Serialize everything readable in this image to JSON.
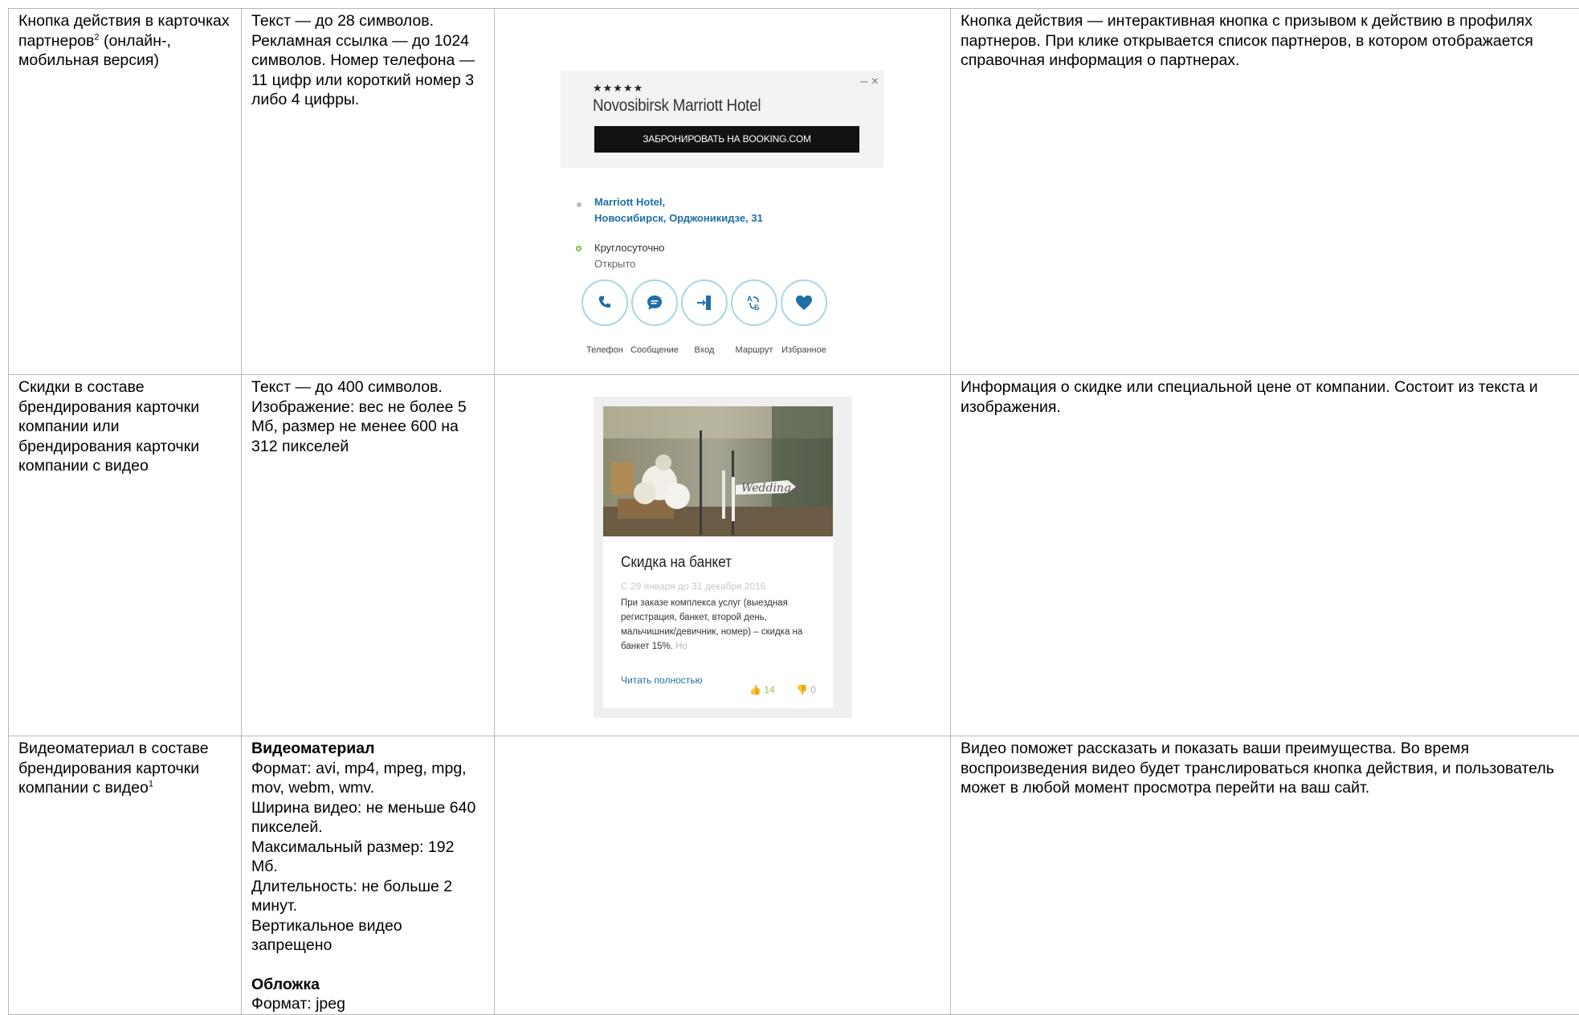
{
  "rows": [
    {
      "name": "Кнопка действия в карточках партнеров",
      "name_sup": "2",
      "name_tail": "(онлайн-, мобильная версия)",
      "requirements": "Текст — до 28 символов. Рекламная ссылка — до 1024 символов. Номер телефона — 11 цифр или короткий номер 3 либо 4 цифры.",
      "description": "Кнопка действия — интерактивная кнопка с призывом к действию в профилях партнеров. При клике открывается список партнеров, в котором отображается справочная информация о партнерах."
    },
    {
      "name": "Скидки в составе брендирования карточки компании или брендирования карточки компании с видео",
      "requirements": "Текст — до 400 символов. Изображение: вес не более 5 Мб, размер не менее 600 на 312 пикселей",
      "description": "Информация о скидке или специальной цене от компании. Состоит из текста и изображения."
    },
    {
      "name": "Видеоматериал в составе брендирования карточки компании с видео",
      "name_sup": "1",
      "video_heading": "Видеоматериал",
      "video_lines": [
        "Формат: avi, mp4, mpeg, mpg, mov, webm, wmv.",
        "Ширина видео: не меньше 640 пикселей.",
        "Максимальный размер: 192 Мб.",
        "Длительность: не больше 2 минут.",
        "Вертикальное видео запрещено"
      ],
      "cover_heading": "Обложка",
      "cover_line": "Формат: jpeg",
      "description": "Видео поможет рассказать и показать ваши преимущества. Во время воспроизведения видео будет транслироваться кнопка действия, и пользователь может в любой момент просмотра перейти на ваш сайт."
    }
  ],
  "partner_card": {
    "stars": "★★★★★",
    "controls": "– ×",
    "hotel": "Novosibirsk Marriott Hotel",
    "book_button": "ЗАБРОНИРОВАТЬ НА BOOKING.COM",
    "address_line1": "Marriott Hotel,",
    "address_line2": "Новосибирск, Орджоникидзе, 31",
    "hours": "Круглосуточно",
    "open_status": "Открыто",
    "actions": [
      {
        "label": "Телефон",
        "icon": "phone-icon"
      },
      {
        "label": "Сообщение",
        "icon": "message-icon"
      },
      {
        "label": "Вход",
        "icon": "entrance-icon"
      },
      {
        "label": "Маршрут",
        "icon": "route-icon"
      },
      {
        "label": "Избранное",
        "icon": "heart-icon"
      }
    ],
    "accent": "#1f6ea8"
  },
  "discount_card": {
    "photo_sign": "Wedding",
    "title": "Скидка на банкет",
    "date": "С 29 января до 31 декабря 2016",
    "text": "При заказе комплекса услуг (выездная регистрация, банкет, второй день, мальчишник/девичник, номер) – скидка на банкет 15%.",
    "text_fade": "Но",
    "read_more": "Читать полностью",
    "likes": "14",
    "dislikes": "0"
  }
}
